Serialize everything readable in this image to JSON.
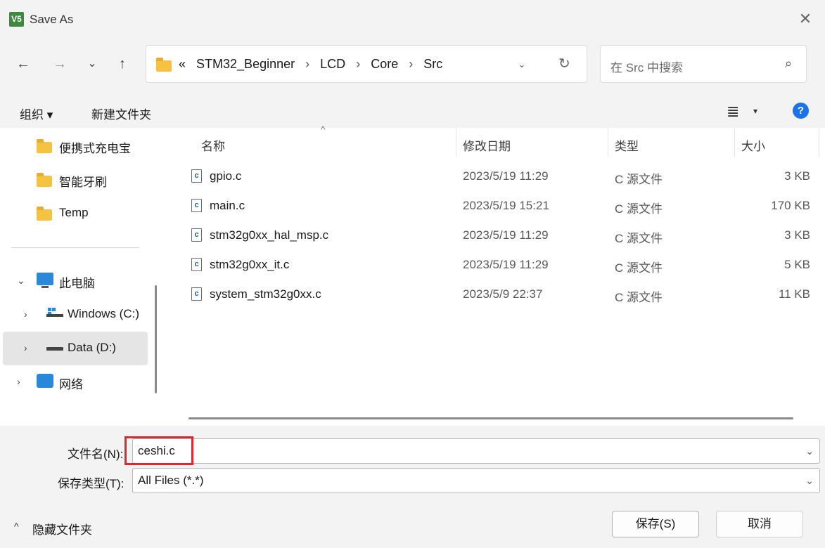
{
  "window": {
    "title": "Save As",
    "app_icon_text": "V5",
    "close_glyph": "✕"
  },
  "nav": {
    "back_glyph": "←",
    "forward_glyph": "→",
    "recent_glyph": "⌄",
    "up_glyph": "↑",
    "breadcrumb_prefix": "«",
    "breadcrumbs": [
      "STM32_Beginner",
      "LCD",
      "Core",
      "Src"
    ],
    "crumb_separator": "›",
    "dropdown_glyph": "⌄",
    "refresh_glyph": "↻",
    "search_placeholder": "在 Src 中搜索",
    "search_glyph": "⌕"
  },
  "toolbar": {
    "organize_label": "组织 ▾",
    "new_folder_label": "新建文件夹",
    "view_glyph": "≣",
    "view_dropdown_glyph": "▾",
    "help_glyph": "?"
  },
  "sidebar": {
    "items": [
      {
        "label": "便携式充电宝",
        "icon": "folder-icon"
      },
      {
        "label": "智能牙刷",
        "icon": "folder-icon"
      },
      {
        "label": "Temp",
        "icon": "folder-icon"
      },
      {
        "label": "此电脑",
        "icon": "computer-icon",
        "chevron": "⌄"
      },
      {
        "label": "Windows (C:)",
        "icon": "windows-drive-icon",
        "chevron": "›"
      },
      {
        "label": "Data (D:)",
        "icon": "drive-icon",
        "chevron": "›",
        "selected": true
      },
      {
        "label": "网络",
        "icon": "network-icon",
        "chevron": "›"
      }
    ]
  },
  "filelist": {
    "columns": {
      "name": "名称",
      "date": "修改日期",
      "type": "类型",
      "size": "大小"
    },
    "sort_glyph": "^",
    "file_icon_text": "c",
    "rows": [
      {
        "name": "gpio.c",
        "date": "2023/5/19 11:29",
        "type": "C 源文件",
        "size": "3 KB"
      },
      {
        "name": "main.c",
        "date": "2023/5/19 15:21",
        "type": "C 源文件",
        "size": "170 KB"
      },
      {
        "name": "stm32g0xx_hal_msp.c",
        "date": "2023/5/19 11:29",
        "type": "C 源文件",
        "size": "3 KB"
      },
      {
        "name": "stm32g0xx_it.c",
        "date": "2023/5/19 11:29",
        "type": "C 源文件",
        "size": "5 KB"
      },
      {
        "name": "system_stm32g0xx.c",
        "date": "2023/5/9 22:37",
        "type": "C 源文件",
        "size": "11 KB"
      }
    ]
  },
  "form": {
    "filename_label": "文件名(N):",
    "filename_value": "ceshi.c",
    "filetype_label": "保存类型(T):",
    "filetype_value": "All Files (*.*)",
    "dropdown_glyph": "⌄"
  },
  "footer": {
    "hide_folders_chevron": "^",
    "hide_folders_label": "隐藏文件夹",
    "save_label": "保存(S)",
    "cancel_label": "取消"
  },
  "colors": {
    "highlight": "#e3262e",
    "accent": "#1a73e8",
    "folder": "#f5c242"
  }
}
